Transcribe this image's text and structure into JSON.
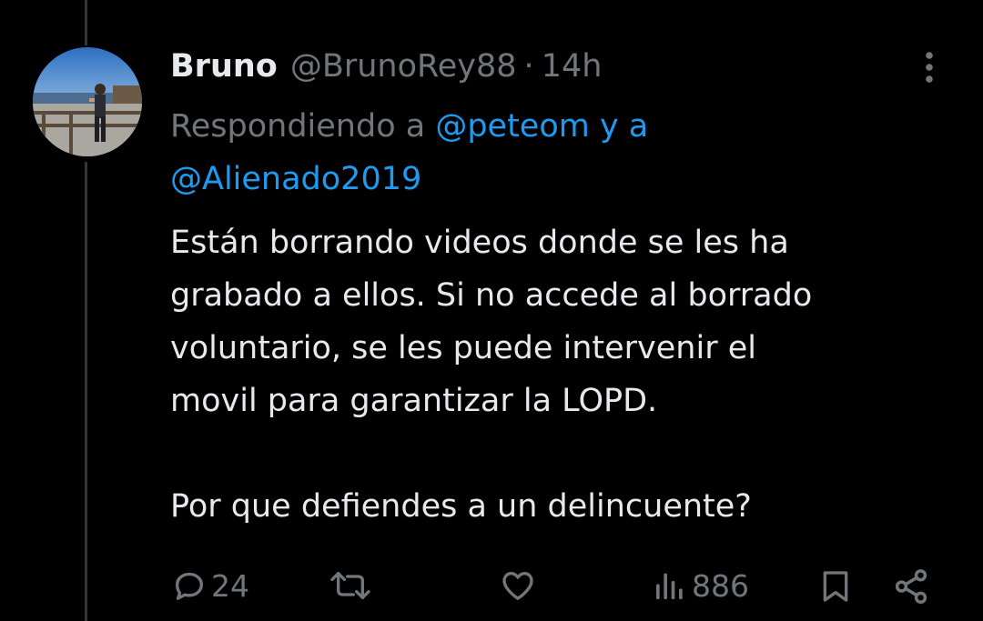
{
  "tweet": {
    "author_name": "Bruno",
    "author_handle": "@BrunoRey88",
    "separator": "·",
    "timestamp": "14h",
    "reply_prefix": "Respondiendo a ",
    "reply_user_1": "@peteom",
    "reply_joiner": " y a",
    "reply_user_2": "@Alienado2019",
    "text_lines": [
      "Están borrando videos donde se les ha",
      "grabado a ellos. Si no accede al borrado",
      "voluntario, se les puede intervenir el",
      "movil para garantizar la LOPD."
    ],
    "text_last": "Por que defiendes a un delincuente?"
  },
  "actions": {
    "reply_count": "24",
    "views_count": "886"
  },
  "icons": {
    "more": "more-vertical-icon",
    "reply": "reply-icon",
    "retweet": "retweet-icon",
    "like": "heart-icon",
    "views": "views-icon",
    "bookmark": "bookmark-icon",
    "share": "share-icon"
  },
  "colors": {
    "background": "#000000",
    "text": "#e7e9ea",
    "muted": "#71767b",
    "link": "#1d9bf0",
    "thread_line": "#333639"
  }
}
